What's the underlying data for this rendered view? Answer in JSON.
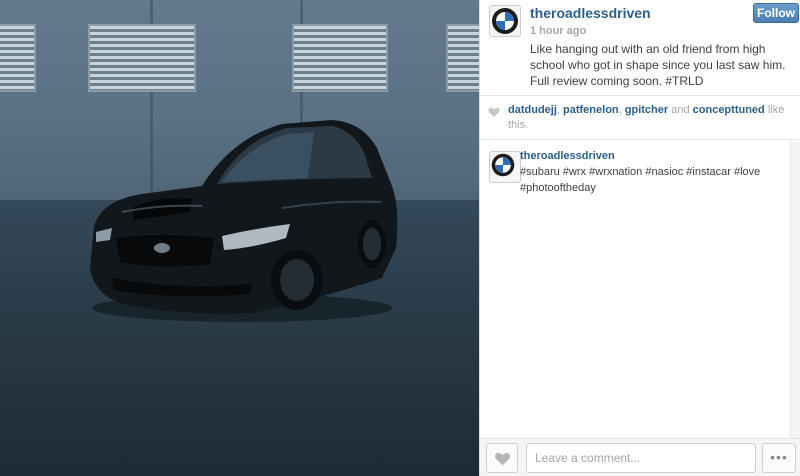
{
  "post": {
    "username": "theroadlessdriven",
    "time_ago": "1 hour ago",
    "caption": "Like hanging out with an old friend from high school who got in shape since you last saw him. Full review coming soon. #TRLD",
    "follow_label": "Follow",
    "avatar_icon": "bmw-logo-icon"
  },
  "likes": {
    "icon": "heart-icon",
    "users": [
      "datdudejj",
      "patfenelon",
      "gpitcher",
      "concepttuned"
    ],
    "sep1": ", ",
    "sep2": ", ",
    "sep3": " and ",
    "suffix": " like this."
  },
  "comments": [
    {
      "username": "theroadlessdriven",
      "text": "#subaru #wrx #wrxnation #nasioc #instacar #love #photooftheday"
    }
  ],
  "footer": {
    "comment_placeholder": "Leave a comment...",
    "more_label": "•••"
  },
  "colors": {
    "link": "#2e5e86",
    "follow_button": "#4a7fb0",
    "muted_text": "#a5a7aa"
  }
}
